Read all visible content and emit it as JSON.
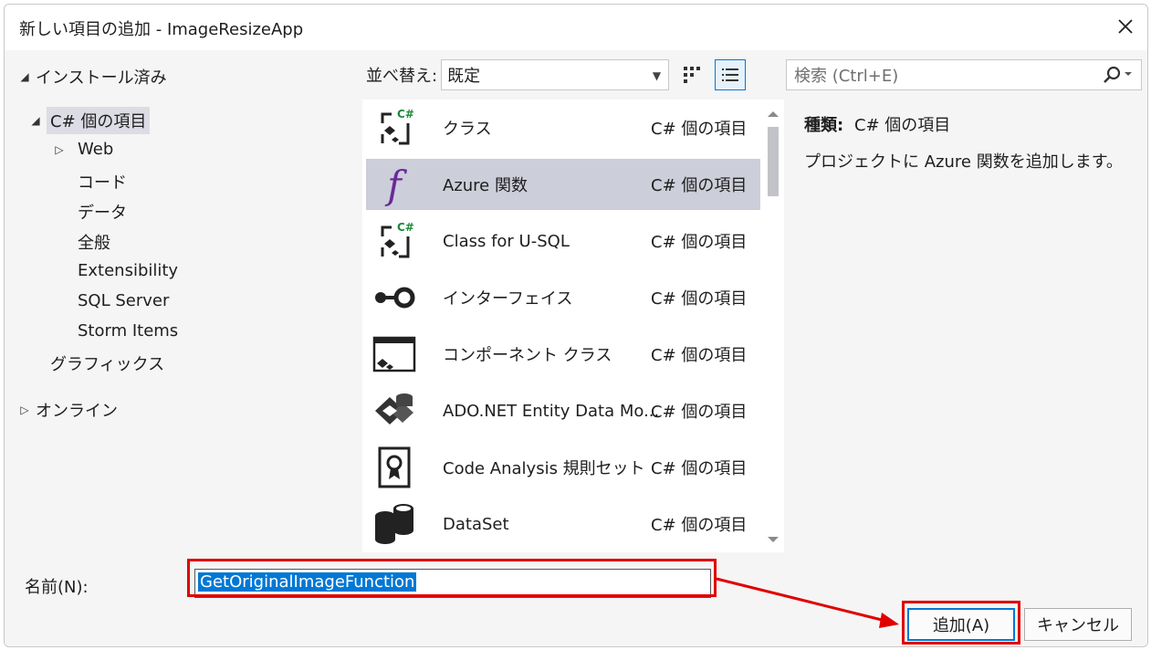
{
  "window": {
    "title": "新しい項目の追加 - ImageResizeApp"
  },
  "tree": {
    "installed": "インストール済み",
    "csharp_items": "C# 個の項目",
    "children": [
      "Web",
      "コード",
      "データ",
      "全般",
      "Extensibility",
      "SQL Server",
      "Storm Items"
    ],
    "graphics": "グラフィックス",
    "online": "オンライン"
  },
  "toolbar": {
    "sort_label": "並べ替え:",
    "sort_value": "既定"
  },
  "search": {
    "placeholder": "検索 (Ctrl+E)"
  },
  "templates": [
    {
      "name": "クラス",
      "category": "C# 個の項目",
      "icon": "csharp-class-icon"
    },
    {
      "name": "Azure 関数",
      "category": "C# 個の項目",
      "icon": "function-icon"
    },
    {
      "name": "Class for U-SQL",
      "category": "C# 個の項目",
      "icon": "csharp-class-icon"
    },
    {
      "name": "インターフェイス",
      "category": "C# 個の項目",
      "icon": "interface-icon"
    },
    {
      "name": "コンポーネント クラス",
      "category": "C# 個の項目",
      "icon": "component-icon"
    },
    {
      "name": "ADO.NET Entity Data Mo...",
      "category": "C# 個の項目",
      "icon": "entity-model-icon"
    },
    {
      "name": "Code Analysis 規則セット",
      "category": "C# 個の項目",
      "icon": "ruleset-icon"
    },
    {
      "name": "DataSet",
      "category": "C# 個の項目",
      "icon": "dataset-icon"
    }
  ],
  "detail": {
    "type_label": "種類:",
    "type_value": "C# 個の項目",
    "description": "プロジェクトに Azure 関数を追加します。"
  },
  "form": {
    "name_label": "名前(N):",
    "name_value": "GetOriginalImageFunction"
  },
  "buttons": {
    "add": "追加(A)",
    "cancel": "キャンセル"
  },
  "colors": {
    "accent": "#0078d4",
    "highlight": "#e00000",
    "selection": "#ccced9"
  }
}
